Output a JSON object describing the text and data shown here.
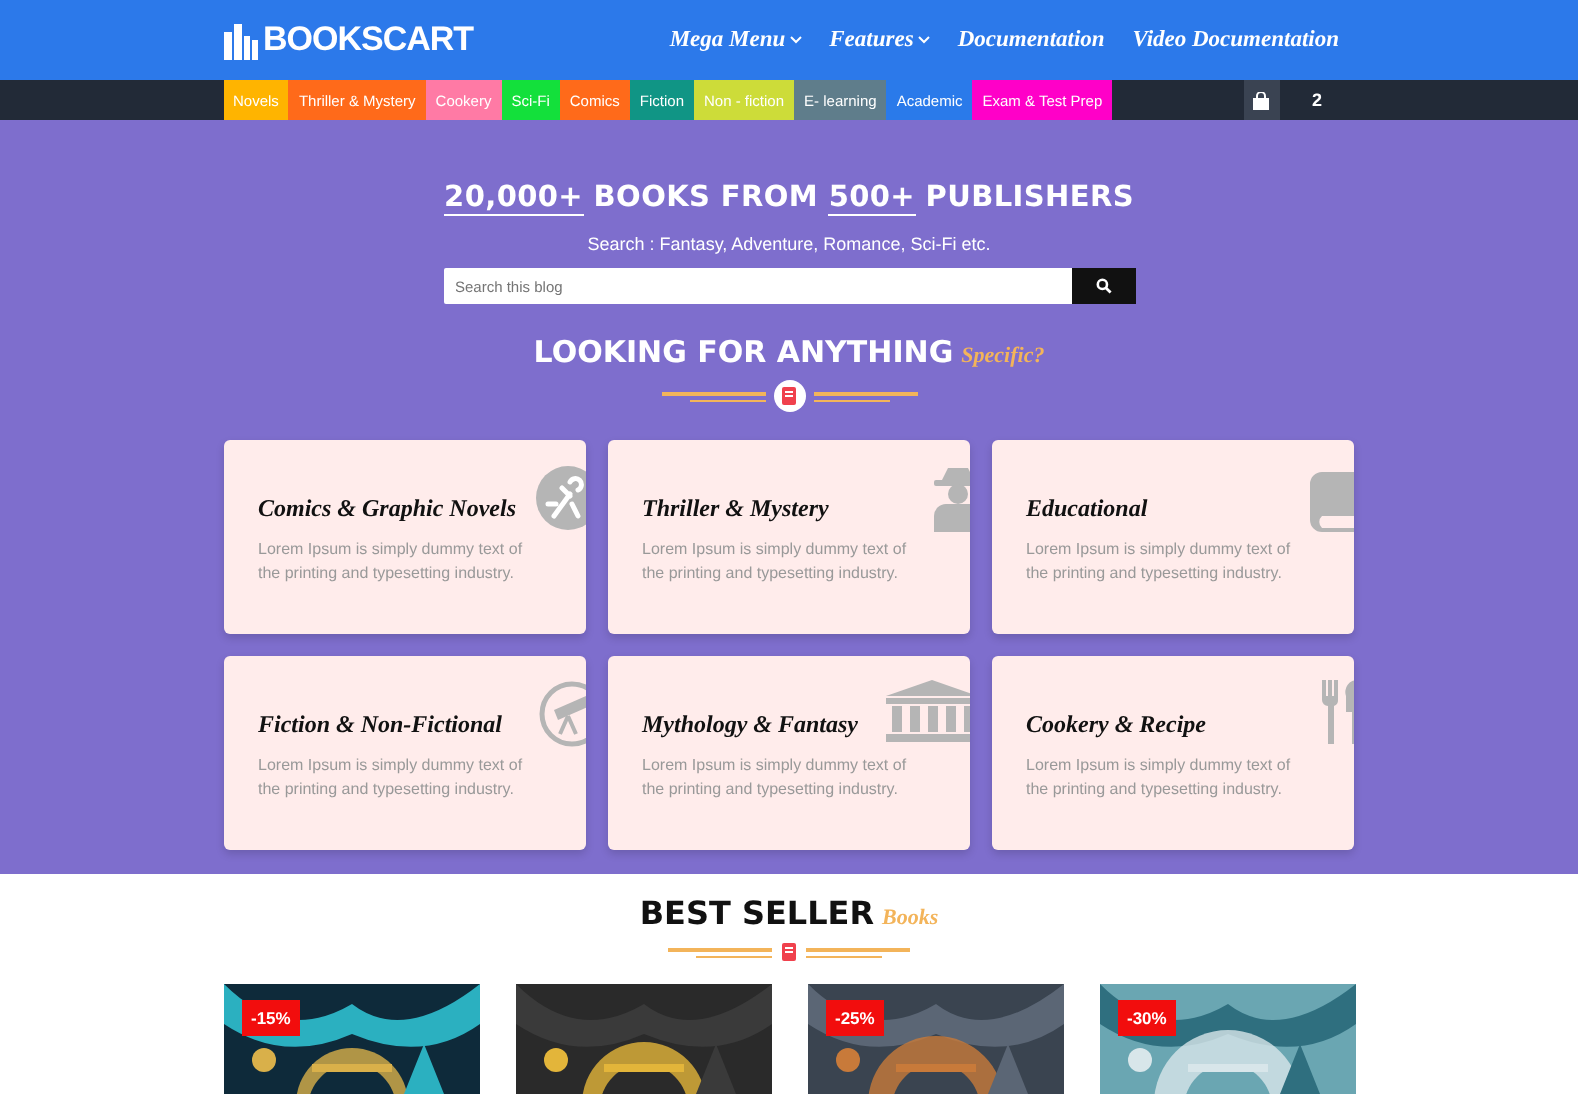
{
  "header": {
    "logo": "BOOKSCART",
    "nav": [
      {
        "label": "Mega Menu",
        "dropdown": true
      },
      {
        "label": "Features",
        "dropdown": true
      },
      {
        "label": "Documentation",
        "dropdown": false
      },
      {
        "label": "Video Documentation",
        "dropdown": false
      }
    ]
  },
  "categories": [
    {
      "label": "Novels",
      "color": "#ffb400"
    },
    {
      "label": "Thriller & Mystery",
      "color": "#ff6a1a"
    },
    {
      "label": "Cookery",
      "color": "#ff7aa5"
    },
    {
      "label": "Sci-Fi",
      "color": "#13e03b"
    },
    {
      "label": "Comics",
      "color": "#ff6a1a"
    },
    {
      "label": "Fiction",
      "color": "#109585"
    },
    {
      "label": "Non - fiction",
      "color": "#cddc39"
    },
    {
      "label": "E- learning",
      "color": "#5f7d8b"
    },
    {
      "label": "Academic",
      "color": "#2a7aea"
    },
    {
      "label": "Exam & Test Prep",
      "color": "#ff00c8"
    }
  ],
  "cart": {
    "count": "2"
  },
  "hero": {
    "headline": [
      {
        "text": "20,000+",
        "underlined": true
      },
      {
        "text": "BOOKS FROM",
        "underlined": false
      },
      {
        "text": "500+",
        "underlined": true
      },
      {
        "text": "PUBLISHERS",
        "underlined": false
      }
    ],
    "subtitle": "Search : Fantasy, Adventure, Romance, Sci-Fi etc.",
    "search": {
      "placeholder": "Search this blog"
    },
    "section_title": "LOOKING FOR ANYTHING",
    "section_accent": "Specific?"
  },
  "cards": [
    {
      "title": "Comics & Graphic Novels",
      "text": "Lorem Ipsum is simply dummy text of the printing and typesetting industry."
    },
    {
      "title": "Thriller & Mystery",
      "text": "Lorem Ipsum is simply dummy text of the printing and typesetting industry."
    },
    {
      "title": "Educational",
      "text": "Lorem Ipsum is simply dummy text of the printing and typesetting industry."
    },
    {
      "title": "Fiction & Non-Fictional",
      "text": "Lorem Ipsum is simply dummy text of the printing and typesetting industry."
    },
    {
      "title": "Mythology & Fantasy",
      "text": "Lorem Ipsum is simply dummy text of the printing and typesetting industry."
    },
    {
      "title": "Cookery & Recipe",
      "text": "Lorem Ipsum is simply dummy text of the printing and typesetting industry."
    }
  ],
  "bestseller": {
    "title": "BEST SELLER",
    "accent": "Books",
    "books": [
      {
        "kind": "picture",
        "badge": "-15%"
      },
      {
        "kind": "picture"
      },
      {
        "kind": "picture",
        "badge": "-25%"
      },
      {
        "kind": "picture",
        "badge": "-30%"
      }
    ]
  }
}
